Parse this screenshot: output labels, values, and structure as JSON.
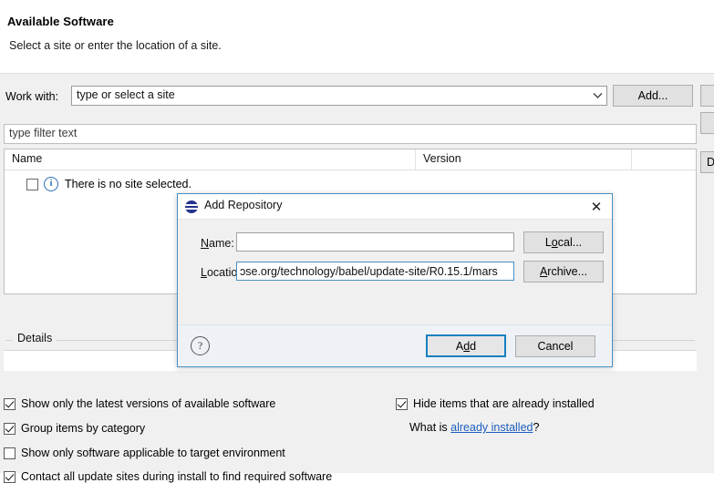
{
  "wizard": {
    "title": "Available Software",
    "description": "Select a site or enter the location of a site.",
    "work_with_label": "Work with:",
    "work_with_value": "type or select a site",
    "add_site_button": "Add...",
    "edge_button_3": "D",
    "filter_placeholder": "type filter text",
    "columns": [
      "Name",
      "Version"
    ],
    "tree_rows": [
      {
        "label": "There is no site selected.",
        "checked": false,
        "icon": "info-icon"
      }
    ],
    "details_legend": "Details",
    "details_text": "",
    "options_left": [
      {
        "label": "Show only the latest versions of available software",
        "checked": true
      },
      {
        "label": "Group items by category",
        "checked": true
      },
      {
        "label": "Show only software applicable to target environment",
        "checked": false
      },
      {
        "label": "Contact all update sites during install to find required software",
        "checked": true
      }
    ],
    "options_right": [
      {
        "label": "Hide items that are already installed",
        "checked": true
      }
    ],
    "what_is_prefix": "What is ",
    "what_is_link": "already installed",
    "what_is_suffix": "?"
  },
  "dialog": {
    "title": "Add Repository",
    "close_label": "✕",
    "name_label": "Name:",
    "name_value": "",
    "location_label": "Location:",
    "location_value": "ɔse.org/technology/babel/update-site/R0.15.1/mars",
    "local_button": "Local...",
    "archive_button": "Archive...",
    "help_label": "?",
    "add_button": "Add",
    "cancel_button": "Cancel"
  },
  "colors": {
    "accent": "#1a7fc1",
    "dialog_border": "#4a90c4",
    "link": "#1c5fbe",
    "info_icon": "#2a6fb5",
    "window_bg": "#f0f0f0"
  }
}
